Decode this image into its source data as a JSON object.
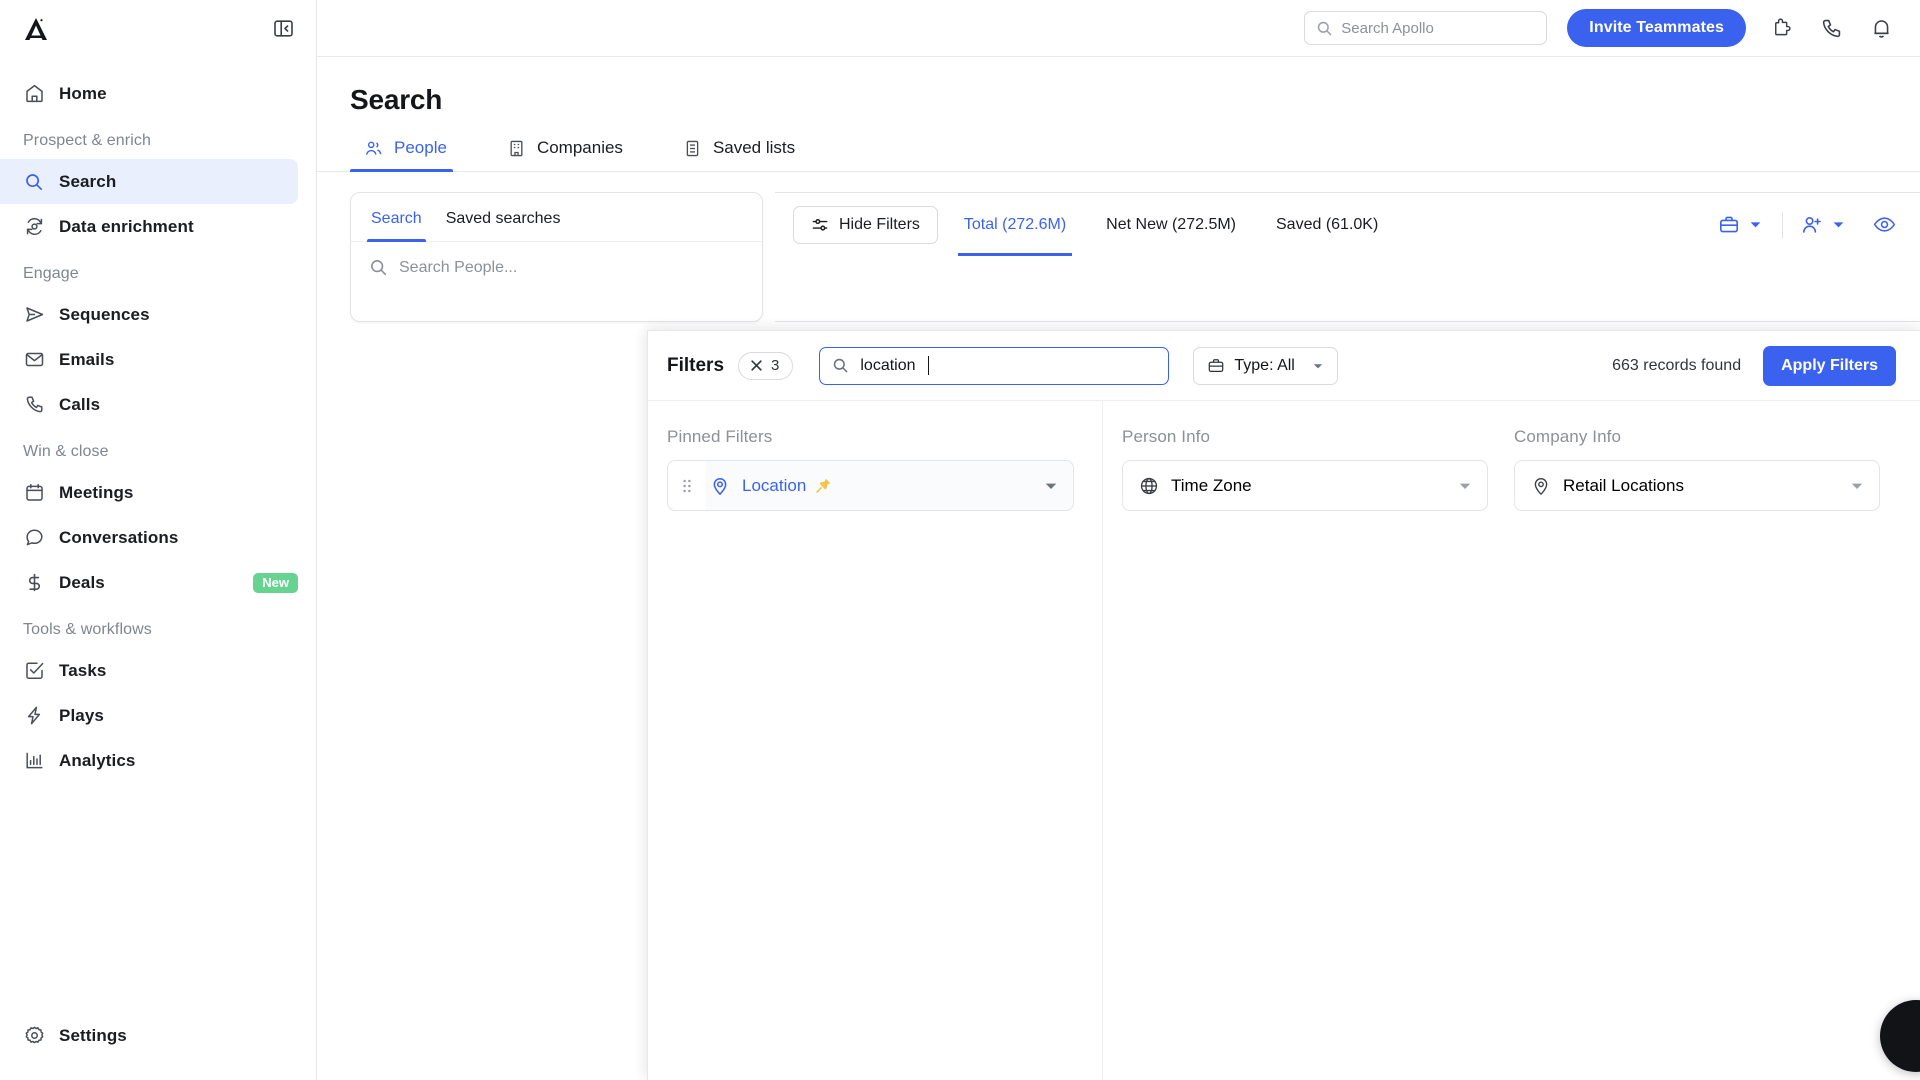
{
  "app": {
    "logo_name": "apollo-logo",
    "collapse_label": "collapse-sidebar"
  },
  "sidebar": {
    "home": {
      "label": "Home",
      "icon": "home-icon"
    },
    "groups": [
      {
        "label": "Prospect & enrich",
        "items": [
          {
            "label": "Search",
            "icon": "search-icon",
            "active": true
          },
          {
            "label": "Data enrichment",
            "icon": "refresh-data-icon",
            "active": false
          }
        ]
      },
      {
        "label": "Engage",
        "items": [
          {
            "label": "Sequences",
            "icon": "send-icon",
            "active": false
          },
          {
            "label": "Emails",
            "icon": "envelope-icon",
            "active": false
          },
          {
            "label": "Calls",
            "icon": "phone-icon",
            "active": false
          }
        ]
      },
      {
        "label": "Win & close",
        "items": [
          {
            "label": "Meetings",
            "icon": "calendar-icon",
            "active": false
          },
          {
            "label": "Conversations",
            "icon": "chat-bubble-icon",
            "active": false
          },
          {
            "label": "Deals",
            "icon": "dollar-icon",
            "active": false,
            "badge": "New"
          }
        ]
      },
      {
        "label": "Tools & workflows",
        "items": [
          {
            "label": "Tasks",
            "icon": "checkbox-icon",
            "active": false
          },
          {
            "label": "Plays",
            "icon": "lightning-icon",
            "active": false
          },
          {
            "label": "Analytics",
            "icon": "bar-chart-icon",
            "active": false
          }
        ]
      }
    ],
    "settings": {
      "label": "Settings",
      "icon": "gear-icon"
    }
  },
  "topbar": {
    "search_placeholder": "Search Apollo",
    "search_icon": "search-icon",
    "invite_label": "Invite Teammates",
    "icons": [
      "puzzle-icon",
      "phone-icon",
      "bell-icon"
    ]
  },
  "page": {
    "title": "Search",
    "tabs": [
      {
        "label": "People",
        "icon": "people-icon",
        "active": true
      },
      {
        "label": "Companies",
        "icon": "building-icon",
        "active": false
      },
      {
        "label": "Saved lists",
        "icon": "list-icon",
        "active": false
      }
    ]
  },
  "search_panel": {
    "tabs": [
      {
        "label": "Search",
        "active": true
      },
      {
        "label": "Saved searches",
        "active": false
      }
    ],
    "input_placeholder": "Search People...",
    "input_value": ""
  },
  "results_toolbar": {
    "hide_filters_label": "Hide Filters",
    "hide_filters_icon": "sliders-icon",
    "tabs": [
      {
        "label": "Total (272.6M)",
        "active": true
      },
      {
        "label": "Net New (272.5M)",
        "active": false
      },
      {
        "label": "Saved (61.0K)",
        "active": false
      }
    ],
    "actions": [
      {
        "name": "briefcase-icon",
        "caret": true
      },
      {
        "name": "add-person-icon",
        "caret": true
      },
      {
        "name": "eye-icon",
        "caret": false
      }
    ]
  },
  "filters_modal": {
    "title": "Filters",
    "clear_count": "3",
    "clear_icon": "close-icon",
    "search_value": "location",
    "search_icon": "search-icon",
    "type_label": "Type: All",
    "type_icon": "briefcase-icon",
    "records_found": "663 records found",
    "apply_label": "Apply Filters",
    "columns": [
      {
        "label": "Pinned Filters",
        "filters": [
          {
            "label": "Location",
            "icon": "map-pin-icon",
            "pinned": true,
            "pin_icon": "pushpin-icon",
            "accent": "#3b62ef"
          }
        ]
      },
      {
        "label": "Person Info",
        "filters": [
          {
            "label": "Time Zone",
            "icon": "globe-icon",
            "pinned": false,
            "accent": "#14161a"
          }
        ]
      },
      {
        "label": "Company Info",
        "filters": [
          {
            "label": "Retail Locations",
            "icon": "map-pin-icon",
            "pinned": false,
            "accent": "#14161a"
          }
        ]
      }
    ]
  },
  "colors": {
    "accent": "#3b62ef",
    "accent_soft": "#e9effc",
    "badge_new": "#67d391",
    "pin_yellow": "#f5c344",
    "text": "#14161a",
    "muted": "#8c9197",
    "border": "#e2e4e8"
  },
  "chat_widget": {
    "name": "help-chat-bubble"
  }
}
